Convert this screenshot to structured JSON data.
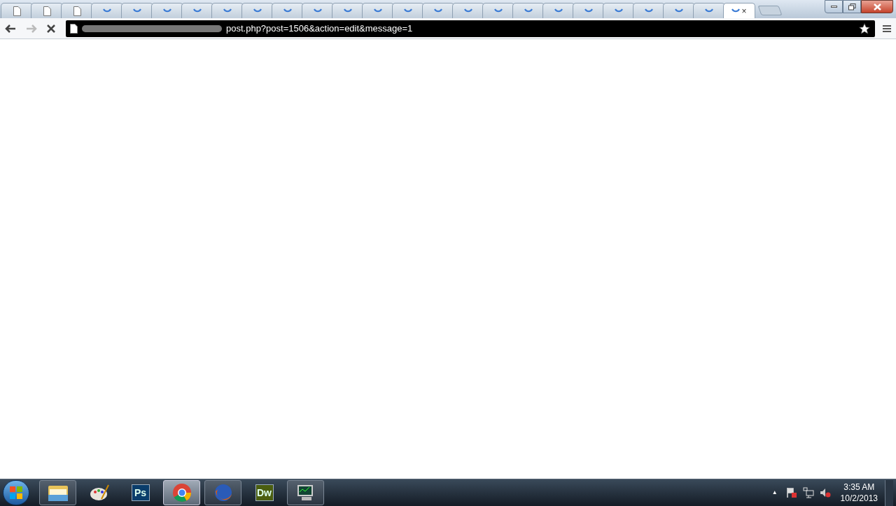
{
  "tabs": [
    {
      "kind": "page",
      "selected": false
    },
    {
      "kind": "page",
      "selected": false
    },
    {
      "kind": "page",
      "selected": false
    },
    {
      "kind": "loading",
      "selected": false
    },
    {
      "kind": "loading",
      "selected": false
    },
    {
      "kind": "loading",
      "selected": false
    },
    {
      "kind": "loading",
      "selected": false
    },
    {
      "kind": "loading",
      "selected": false
    },
    {
      "kind": "loading",
      "selected": false
    },
    {
      "kind": "loading",
      "selected": false
    },
    {
      "kind": "loading",
      "selected": false
    },
    {
      "kind": "loading",
      "selected": false
    },
    {
      "kind": "loading",
      "selected": false
    },
    {
      "kind": "loading",
      "selected": false
    },
    {
      "kind": "loading",
      "selected": false
    },
    {
      "kind": "loading",
      "selected": false
    },
    {
      "kind": "loading",
      "selected": false
    },
    {
      "kind": "loading",
      "selected": false
    },
    {
      "kind": "loading",
      "selected": false
    },
    {
      "kind": "loading",
      "selected": false
    },
    {
      "kind": "loading",
      "selected": false
    },
    {
      "kind": "loading",
      "selected": false
    },
    {
      "kind": "loading",
      "selected": false
    },
    {
      "kind": "loading",
      "selected": false
    },
    {
      "kind": "loading",
      "selected": true,
      "close": "×"
    }
  ],
  "toolbar": {
    "back_disabled": false,
    "forward_disabled": true,
    "url": "post.php?post=1506&action=edit&message=1"
  },
  "taskbar": {
    "apps": [
      {
        "kind": "folder",
        "running": true,
        "selected": false
      },
      {
        "kind": "paint",
        "running": false,
        "selected": false
      },
      {
        "kind": "badge",
        "label": "Ps",
        "color": "#0a3d6b",
        "running": false,
        "selected": false
      },
      {
        "kind": "chrome",
        "running": true,
        "selected": true
      },
      {
        "kind": "firefox",
        "running": true,
        "selected": false
      },
      {
        "kind": "badge",
        "label": "Dw",
        "color": "#4b5e10",
        "running": false,
        "selected": false
      },
      {
        "kind": "monitor",
        "running": true,
        "selected": false
      }
    ],
    "tray": {
      "show_hidden": "▲",
      "time": "3:35 AM",
      "date": "10/2/2013"
    }
  }
}
